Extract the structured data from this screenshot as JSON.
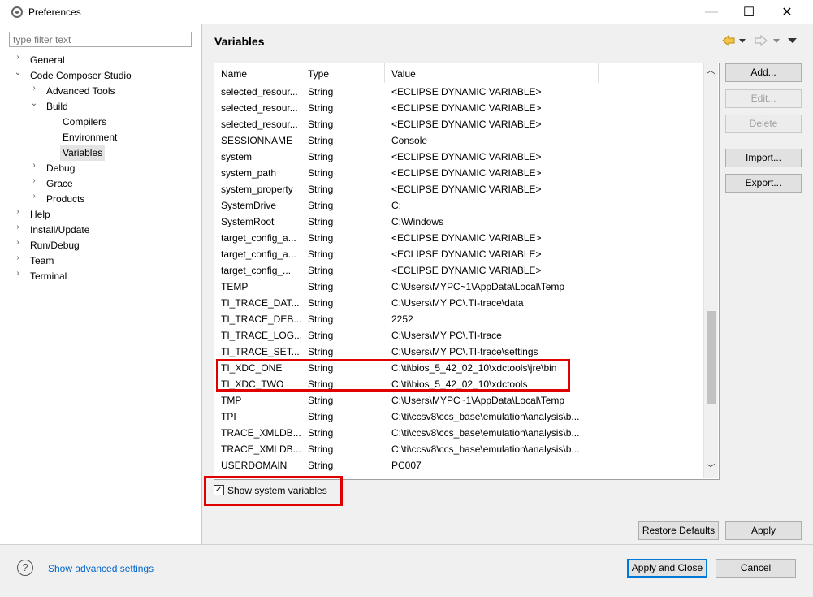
{
  "window": {
    "title": "Preferences",
    "minimize_glyph": "—",
    "maximize_glyph": "☐",
    "close_glyph": "✕"
  },
  "filter": {
    "placeholder": "type filter text",
    "value": ""
  },
  "tree": [
    {
      "label": "General",
      "expanded": false
    },
    {
      "label": "Code Composer Studio",
      "expanded": true
    },
    {
      "label": "Advanced Tools",
      "expanded": false
    },
    {
      "label": "Build",
      "expanded": true
    },
    {
      "label": "Compilers"
    },
    {
      "label": "Environment"
    },
    {
      "label": "Variables",
      "selected": true
    },
    {
      "label": "Debug",
      "expanded": false
    },
    {
      "label": "Grace",
      "expanded": false
    },
    {
      "label": "Products",
      "expanded": false
    },
    {
      "label": "Help",
      "expanded": false
    },
    {
      "label": "Install/Update",
      "expanded": false
    },
    {
      "label": "Run/Debug",
      "expanded": false
    },
    {
      "label": "Team",
      "expanded": false
    },
    {
      "label": "Terminal",
      "expanded": false
    }
  ],
  "page": {
    "title": "Variables"
  },
  "table": {
    "columns": [
      "Name",
      "Type",
      "Value"
    ],
    "rows": [
      [
        "selected_resour...",
        "String",
        "<ECLIPSE DYNAMIC VARIABLE>"
      ],
      [
        "selected_resour...",
        "String",
        "<ECLIPSE DYNAMIC VARIABLE>"
      ],
      [
        "selected_resour...",
        "String",
        "<ECLIPSE DYNAMIC VARIABLE>"
      ],
      [
        "SESSIONNAME",
        "String",
        "Console"
      ],
      [
        "system",
        "String",
        "<ECLIPSE DYNAMIC VARIABLE>"
      ],
      [
        "system_path",
        "String",
        "<ECLIPSE DYNAMIC VARIABLE>"
      ],
      [
        "system_property",
        "String",
        "<ECLIPSE DYNAMIC VARIABLE>"
      ],
      [
        "SystemDrive",
        "String",
        "C:"
      ],
      [
        "SystemRoot",
        "String",
        "C:\\Windows"
      ],
      [
        "target_config_a...",
        "String",
        "<ECLIPSE DYNAMIC VARIABLE>"
      ],
      [
        "target_config_a...",
        "String",
        "<ECLIPSE DYNAMIC VARIABLE>"
      ],
      [
        "target_config_...",
        "String",
        "<ECLIPSE DYNAMIC VARIABLE>"
      ],
      [
        "TEMP",
        "String",
        "C:\\Users\\MYPC~1\\AppData\\Local\\Temp"
      ],
      [
        "TI_TRACE_DAT...",
        "String",
        "C:\\Users\\MY PC\\.TI-trace\\data"
      ],
      [
        "TI_TRACE_DEB...",
        "String",
        "2252"
      ],
      [
        "TI_TRACE_LOG...",
        "String",
        "C:\\Users\\MY PC\\.TI-trace"
      ],
      [
        "TI_TRACE_SET...",
        "String",
        "C:\\Users\\MY PC\\.TI-trace\\settings"
      ],
      [
        "TI_XDC_ONE",
        "String",
        "C:\\ti\\bios_5_42_02_10\\xdctools\\jre\\bin"
      ],
      [
        "TI_XDC_TWO",
        "String",
        "C:\\ti\\bios_5_42_02_10\\xdctools"
      ],
      [
        "TMP",
        "String",
        "C:\\Users\\MYPC~1\\AppData\\Local\\Temp"
      ],
      [
        "TPI",
        "String",
        "C:\\ti\\ccsv8\\ccs_base\\emulation\\analysis\\b..."
      ],
      [
        "TRACE_XMLDB...",
        "String",
        "C:\\ti\\ccsv8\\ccs_base\\emulation\\analysis\\b..."
      ],
      [
        "TRACE_XMLDB...",
        "String",
        "C:\\ti\\ccsv8\\ccs_base\\emulation\\analysis\\b..."
      ],
      [
        "USERDOMAIN",
        "String",
        "PC007"
      ]
    ]
  },
  "buttons": {
    "add": "Add...",
    "edit": "Edit...",
    "delete": "Delete",
    "import": "Import...",
    "export": "Export...",
    "restore_defaults": "Restore Defaults",
    "apply": "Apply",
    "apply_and_close": "Apply and Close",
    "cancel": "Cancel"
  },
  "show_system_variables": {
    "label": "Show system variables",
    "checked": true
  },
  "footer": {
    "advanced_link": "Show advanced settings"
  },
  "colors": {
    "highlight": "#e00000",
    "link": "#0066cc"
  }
}
